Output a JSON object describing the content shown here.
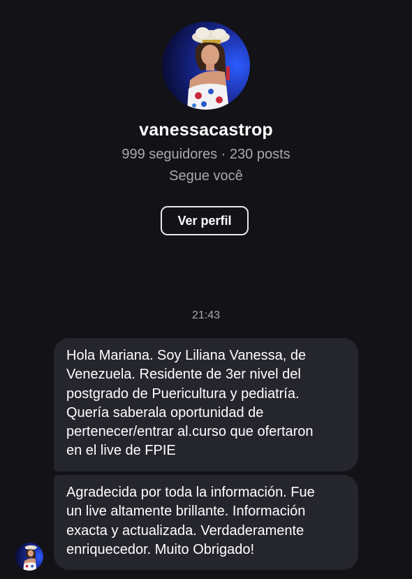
{
  "profile": {
    "avatar_icon": "profile-photo",
    "username": "vanessacastrop",
    "stats": "999 seguidores · 230 posts",
    "follow_status": "Segue você",
    "view_profile_label": "Ver perfil"
  },
  "conversation": {
    "timestamp": "21:43",
    "messages": [
      {
        "text": "Hola Mariana. Soy Liliana Vanessa, de\nVenezuela. Residente de 3er nivel del\npostgrado de Puericultura y pediatría.\nQuería saberala oportunidad de\npertenecer/entrar al.curso que ofertaron\nen el live de FPIE"
      },
      {
        "text": "Agradecida por toda la información. Fue\nun live altamente brillante. Información\nexacta y actualizada. Verdaderamente\nenriquecedor. Muito Obrigado!"
      }
    ]
  },
  "colors": {
    "background": "#121217",
    "bubble": "#25252d",
    "secondary_text": "#a8a8ae",
    "button_border": "#e8e8ea"
  }
}
